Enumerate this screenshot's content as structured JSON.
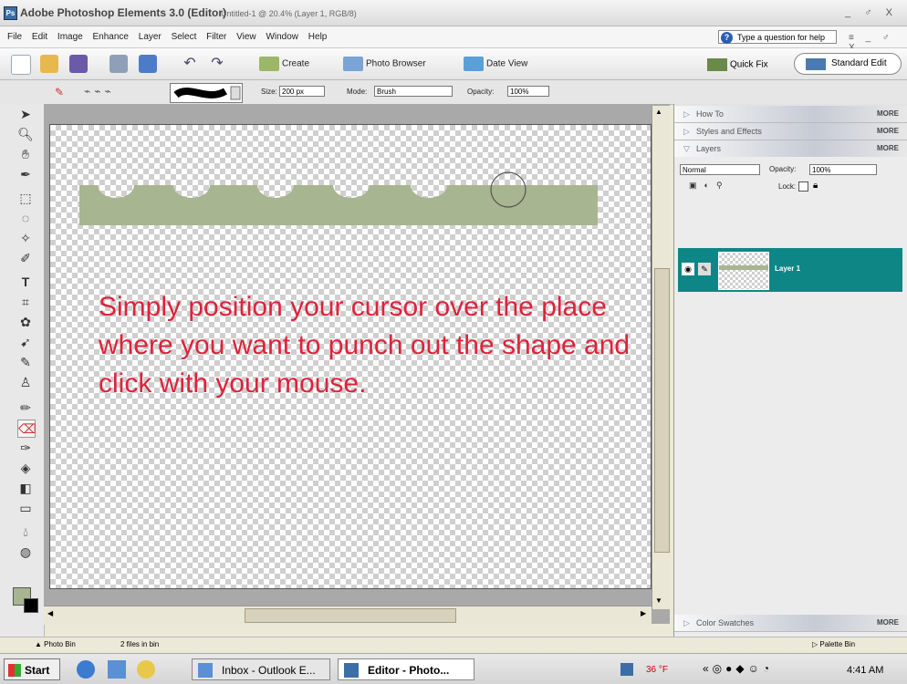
{
  "window": {
    "app_title": "Adobe Photoshop Elements 3.0 (Editor)",
    "doc_title": "Untitled-1 @ 20.4% (Layer 1, RGB/8)",
    "controls": "_ ♂ X"
  },
  "menu": {
    "items": [
      "File",
      "Edit",
      "Image",
      "Enhance",
      "Layer",
      "Select",
      "Filter",
      "View",
      "Window",
      "Help"
    ],
    "help_placeholder": "Type a question for help",
    "controls": "≡ _ ♂ X"
  },
  "toolbar": {
    "create": "Create",
    "photo_browser": "Photo Browser",
    "date_view": "Date View",
    "quick_fix": "Quick Fix",
    "standard_edit": "Standard Edit"
  },
  "options": {
    "size_label": "Size:",
    "size_value": "200 px",
    "mode_label": "Mode:",
    "mode_value": "Brush",
    "opacity_label": "Opacity:",
    "opacity_value": "100%"
  },
  "canvas": {
    "instruction": "Simply position your cursor over the place where you want to punch out the shape and click with your mouse.",
    "strip_color": "#a7b590"
  },
  "panel": {
    "how_to": "How To",
    "styles": "Styles and Effects",
    "layers": "Layers",
    "more": "MORE",
    "blend_mode": "Normal",
    "opacity_label": "Opacity:",
    "opacity_value": "100%",
    "lock_label": "Lock:",
    "layer_name": "Layer 1",
    "color_swatches": "Color Swatches"
  },
  "status": {
    "photo_bin": "Photo Bin",
    "files": "2 files in bin",
    "palette_bin": "Palette Bin"
  },
  "taskbar": {
    "start": "Start",
    "task_outlook": "Inbox - Outlook E...",
    "task_editor": "Editor - Photo...",
    "temp": "36 °F",
    "clock": "4:41 AM"
  }
}
